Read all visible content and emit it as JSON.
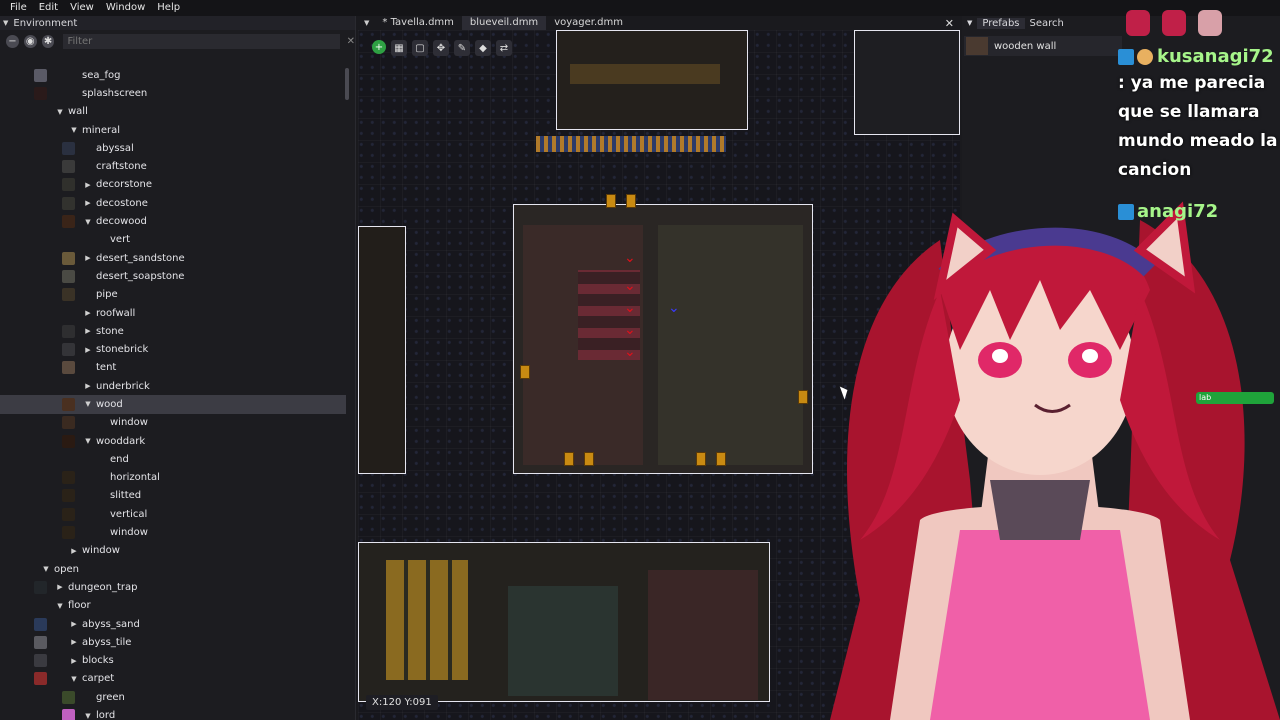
{
  "menu": [
    "File",
    "Edit",
    "View",
    "Window",
    "Help"
  ],
  "left_panel": {
    "title": "Environment",
    "filter_placeholder": "Filter",
    "tree": [
      {
        "label": "sea_fog",
        "depth": 2,
        "arrow": "",
        "thumb": "#5a5a66"
      },
      {
        "label": "splashscreen",
        "depth": 2,
        "arrow": "",
        "thumb": "#2a1a1a"
      },
      {
        "label": "wall",
        "depth": 1,
        "arrow": "▼",
        "thumb": ""
      },
      {
        "label": "mineral",
        "depth": 2,
        "arrow": "▼",
        "thumb": ""
      },
      {
        "label": "abyssal",
        "depth": 3,
        "arrow": "",
        "thumb": "#2a3040"
      },
      {
        "label": "craftstone",
        "depth": 3,
        "arrow": "",
        "thumb": "#3a3a3a"
      },
      {
        "label": "decorstone",
        "depth": 3,
        "arrow": "▶",
        "thumb": "#30302c"
      },
      {
        "label": "decostone",
        "depth": 3,
        "arrow": "▶",
        "thumb": "#32322e"
      },
      {
        "label": "decowood",
        "depth": 3,
        "arrow": "▼",
        "thumb": "#3a2418"
      },
      {
        "label": "vert",
        "depth": 4,
        "arrow": "",
        "thumb": ""
      },
      {
        "label": "desert_sandstone",
        "depth": 3,
        "arrow": "▶",
        "thumb": "#6a5a3a"
      },
      {
        "label": "desert_soapstone",
        "depth": 3,
        "arrow": "",
        "thumb": "#4a4a44"
      },
      {
        "label": "pipe",
        "depth": 3,
        "arrow": "",
        "thumb": "#3a3226"
      },
      {
        "label": "roofwall",
        "depth": 3,
        "arrow": "▶",
        "thumb": ""
      },
      {
        "label": "stone",
        "depth": 3,
        "arrow": "▶",
        "thumb": "#2e2e30"
      },
      {
        "label": "stonebrick",
        "depth": 3,
        "arrow": "▶",
        "thumb": "#343438"
      },
      {
        "label": "tent",
        "depth": 3,
        "arrow": "",
        "thumb": "#5a4a3e"
      },
      {
        "label": "underbrick",
        "depth": 3,
        "arrow": "▶",
        "thumb": ""
      },
      {
        "label": "wood",
        "depth": 3,
        "arrow": "▼",
        "thumb": "#4a3020",
        "selected": true
      },
      {
        "label": "window",
        "depth": 4,
        "arrow": "",
        "thumb": "#3a2a20"
      },
      {
        "label": "wooddark",
        "depth": 3,
        "arrow": "▼",
        "thumb": "#2a1a12"
      },
      {
        "label": "end",
        "depth": 4,
        "arrow": "",
        "thumb": ""
      },
      {
        "label": "horizontal",
        "depth": 4,
        "arrow": "",
        "thumb": "#2a2218"
      },
      {
        "label": "slitted",
        "depth": 4,
        "arrow": "",
        "thumb": "#2a2218"
      },
      {
        "label": "vertical",
        "depth": 4,
        "arrow": "",
        "thumb": "#2a2218"
      },
      {
        "label": "window",
        "depth": 4,
        "arrow": "",
        "thumb": "#2a2218"
      },
      {
        "label": "window",
        "depth": 2,
        "arrow": "▶",
        "thumb": ""
      },
      {
        "label": "open",
        "depth": 0,
        "arrow": "▼",
        "thumb": ""
      },
      {
        "label": "dungeon_trap",
        "depth": 1,
        "arrow": "▶",
        "thumb": "#22262a"
      },
      {
        "label": "floor",
        "depth": 1,
        "arrow": "▼",
        "thumb": ""
      },
      {
        "label": "abyss_sand",
        "depth": 2,
        "arrow": "▶",
        "thumb": "#2a3a5a"
      },
      {
        "label": "abyss_tile",
        "depth": 2,
        "arrow": "▶",
        "thumb": "#5a5a60"
      },
      {
        "label": "blocks",
        "depth": 2,
        "arrow": "▶",
        "thumb": "#3a3a40"
      },
      {
        "label": "carpet",
        "depth": 2,
        "arrow": "▼",
        "thumb": "#8a2a2a"
      },
      {
        "label": "green",
        "depth": 3,
        "arrow": "",
        "thumb": "#3a4a2a"
      },
      {
        "label": "lord",
        "depth": 3,
        "arrow": "▼",
        "thumb": "#c060c0"
      }
    ]
  },
  "editor": {
    "tabs": [
      "* Tavella.dmm",
      "blueveil.dmm",
      "voyager.dmm"
    ],
    "active_tab": 1,
    "coord_readout": "X:120 Y:091"
  },
  "right_panel": {
    "tabs": [
      "Prefabs",
      "Search"
    ],
    "prefab_item": "wooden wall"
  },
  "chat": {
    "username": "kusanagi72",
    "message_lines": [
      ": ya me parecia",
      "que se llamara",
      "mundo meado la",
      "cancion"
    ],
    "username_partial": "anagi72",
    "green_label": "lab"
  },
  "colors": {
    "accent_green": "#2ea043",
    "chat_name": "#a6f58a",
    "selection": "#3c3c44"
  }
}
